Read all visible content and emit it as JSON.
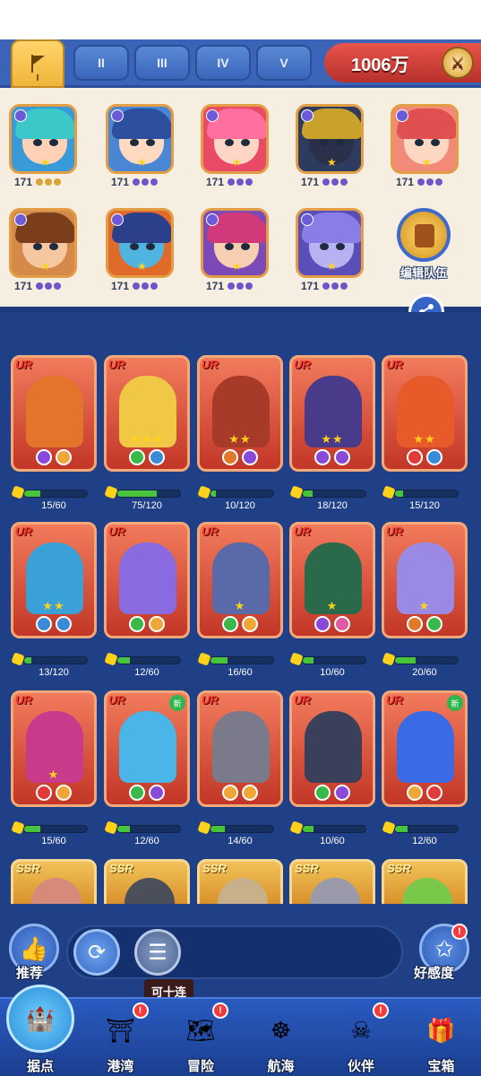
{
  "header": {
    "tabs": [
      {
        "label": "I",
        "active": true,
        "icon": "flag-icon"
      },
      {
        "label": "II",
        "active": false
      },
      {
        "label": "III",
        "active": false
      },
      {
        "label": "IV",
        "active": false
      },
      {
        "label": "V",
        "active": false
      }
    ],
    "currency": "1006万",
    "currency_icon": "crossed-swords-icon"
  },
  "team": {
    "heroes": [
      {
        "level": "171",
        "hair": "#3cc7c9",
        "skin": "#ffd2b8",
        "bg": "#3a9ad8",
        "dots": [
          "#d9a437",
          "#d9a437",
          "#d9a437"
        ]
      },
      {
        "level": "171",
        "hair": "#2c4f9e",
        "skin": "#ffd9c0",
        "bg": "#4a86d4",
        "dots": [
          "#6e56c9",
          "#6e56c9",
          "#6e56c9"
        ]
      },
      {
        "level": "171",
        "hair": "#ff6fa0",
        "skin": "#ffd6c6",
        "bg": "#e84a68",
        "dots": [
          "#6e56c9",
          "#6e56c9",
          "#6e56c9"
        ]
      },
      {
        "level": "171",
        "hair": "#c9a22c",
        "skin": "#2a2f4a",
        "bg": "#2d3b5e",
        "dots": [
          "#6e56c9",
          "#6e56c9",
          "#6e56c9"
        ]
      },
      {
        "level": "171",
        "hair": "#e05050",
        "skin": "#ffd8c4",
        "bg": "#f28a7a",
        "dots": [
          "#6e56c9",
          "#6e56c9",
          "#6e56c9"
        ]
      },
      {
        "level": "171",
        "hair": "#7a3e1c",
        "skin": "#f5c8a2",
        "bg": "#d58a4a",
        "dots": [
          "#6e56c9",
          "#6e56c9",
          "#6e56c9"
        ]
      },
      {
        "level": "171",
        "hair": "#2c3f8a",
        "skin": "#4fb4e0",
        "bg": "#e06a2a",
        "dots": [
          "#6e56c9",
          "#6e56c9",
          "#6e56c9"
        ]
      },
      {
        "level": "171",
        "hair": "#d03a7a",
        "skin": "#f7cfb3",
        "bg": "#7b4ab8",
        "dots": [
          "#6e56c9",
          "#6e56c9",
          "#6e56c9"
        ]
      },
      {
        "level": "171",
        "hair": "#8a7ee6",
        "skin": "#b8b2f2",
        "bg": "#5a4fb8",
        "dots": [
          "#6e56c9",
          "#6e56c9",
          "#6e56c9"
        ]
      }
    ],
    "edit_label": "编辑队伍"
  },
  "heroes": [
    {
      "rarity": "UR",
      "stars": "",
      "fragments": "15/60",
      "progress": 0.25,
      "figure": "#e3752a",
      "elems": [
        "#8a4ad8",
        "#f0a73a"
      ],
      "new": false
    },
    {
      "rarity": "UR",
      "stars": "★★★",
      "fragments": "75/120",
      "progress": 0.625,
      "figure": "#f0c845",
      "elems": [
        "#3ab84a",
        "#3a8ad8"
      ],
      "new": false
    },
    {
      "rarity": "UR",
      "stars": "★★",
      "fragments": "10/120",
      "progress": 0.083,
      "figure": "#a83a2a",
      "elems": [
        "#e07a2a",
        "#8a4ad8"
      ],
      "new": false
    },
    {
      "rarity": "UR",
      "stars": "★★",
      "fragments": "18/120",
      "progress": 0.15,
      "figure": "#4a3a8a",
      "elems": [
        "#8a4ad8",
        "#8a4ad8"
      ],
      "new": false
    },
    {
      "rarity": "UR",
      "stars": "★★",
      "fragments": "15/120",
      "progress": 0.125,
      "figure": "#e85a2a",
      "elems": [
        "#e03a3a",
        "#3a8ad8"
      ],
      "new": false
    },
    {
      "rarity": "UR",
      "stars": "★★",
      "fragments": "13/120",
      "progress": 0.108,
      "figure": "#3aa0d8",
      "elems": [
        "#3a8ad8",
        "#3a8ad8"
      ],
      "new": false
    },
    {
      "rarity": "UR",
      "stars": "",
      "fragments": "12/60",
      "progress": 0.2,
      "figure": "#8a6ae0",
      "elems": [
        "#3ab84a",
        "#f0a73a"
      ],
      "new": false
    },
    {
      "rarity": "UR",
      "stars": "★",
      "fragments": "16/60",
      "progress": 0.267,
      "figure": "#5a6aa8",
      "elems": [
        "#3ab84a",
        "#f0a73a"
      ],
      "new": false
    },
    {
      "rarity": "UR",
      "stars": "★",
      "fragments": "10/60",
      "progress": 0.167,
      "figure": "#2a6a4a",
      "elems": [
        "#8a4ad8",
        "#e05aa0"
      ],
      "new": false
    },
    {
      "rarity": "UR",
      "stars": "★",
      "fragments": "20/60",
      "progress": 0.333,
      "figure": "#9a8ae6",
      "elems": [
        "#e07a2a",
        "#3ab84a"
      ],
      "new": false
    },
    {
      "rarity": "UR",
      "stars": "★",
      "fragments": "15/60",
      "progress": 0.25,
      "figure": "#c83a8a",
      "elems": [
        "#e03a3a",
        "#f0a73a"
      ],
      "new": false
    },
    {
      "rarity": "UR",
      "stars": "",
      "fragments": "12/60",
      "progress": 0.2,
      "figure": "#4ab6e8",
      "elems": [
        "#3ab84a",
        "#8a4ad8"
      ],
      "new": true
    },
    {
      "rarity": "UR",
      "stars": "",
      "fragments": "14/60",
      "progress": 0.233,
      "figure": "#7a7a8a",
      "elems": [
        "#f0a73a",
        "#f0a73a"
      ],
      "new": false
    },
    {
      "rarity": "UR",
      "stars": "",
      "fragments": "10/60",
      "progress": 0.167,
      "figure": "#3a3f5a",
      "elems": [
        "#3ab84a",
        "#8a4ad8"
      ],
      "new": false
    },
    {
      "rarity": "UR",
      "stars": "",
      "fragments": "12/60",
      "progress": 0.2,
      "figure": "#3a6ae6",
      "elems": [
        "#f0a73a",
        "#e03a3a"
      ],
      "new": true
    }
  ],
  "ssr_heroes": [
    {
      "rarity": "SSR",
      "figure": "#d88a7a"
    },
    {
      "rarity": "SSR",
      "figure": "#4a4f5a"
    },
    {
      "rarity": "SSR",
      "figure": "#c8b08a"
    },
    {
      "rarity": "SSR",
      "figure": "#9a9aaa"
    },
    {
      "rarity": "SSR",
      "figure": "#7ac84a"
    }
  ],
  "controls": {
    "recommend_label": "推荐",
    "affection_label": "好感度",
    "tooltip": "可十连"
  },
  "nav": [
    {
      "label": "据点",
      "icon": "base-icon",
      "active": true,
      "alert": false
    },
    {
      "label": "港湾",
      "icon": "harbor-icon",
      "active": false,
      "alert": true
    },
    {
      "label": "冒险",
      "icon": "map-icon",
      "active": false,
      "alert": true
    },
    {
      "label": "航海",
      "icon": "helm-icon",
      "active": false,
      "alert": false
    },
    {
      "label": "伙伴",
      "icon": "pirate-icon",
      "active": false,
      "alert": true
    },
    {
      "label": "宝箱",
      "icon": "chest-icon",
      "active": false,
      "alert": false
    }
  ]
}
